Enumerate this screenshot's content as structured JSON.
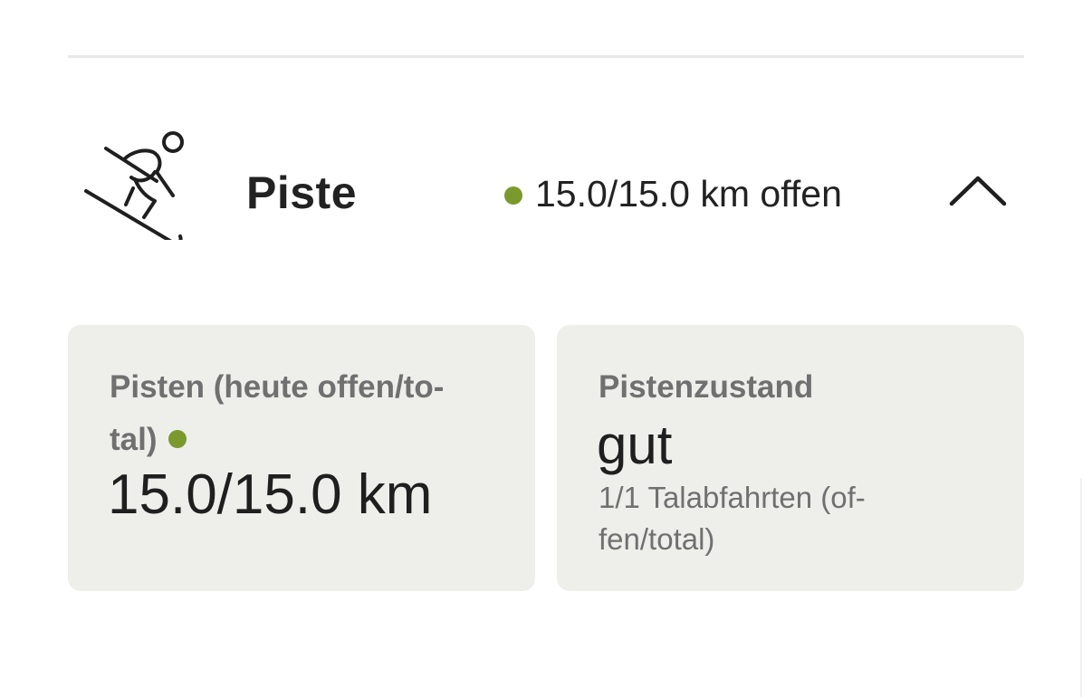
{
  "section": {
    "icon": "skier-icon",
    "title": "Piste",
    "status_text": "15.0/15.0 km offen",
    "status_color": "#7a9a2e",
    "toggle_icon": "chevron-up-icon"
  },
  "cards": {
    "slopes": {
      "label_line1": "Pisten (heute offen/to-",
      "label_line2": "tal)",
      "status_color": "#7a9a2e",
      "value": "15.0/15.0 km"
    },
    "condition": {
      "label": "Pistenzustand",
      "value": "gut",
      "sub_line1": "1/1 Talabfahrten (of-",
      "sub_line2": "fen/total)"
    }
  }
}
